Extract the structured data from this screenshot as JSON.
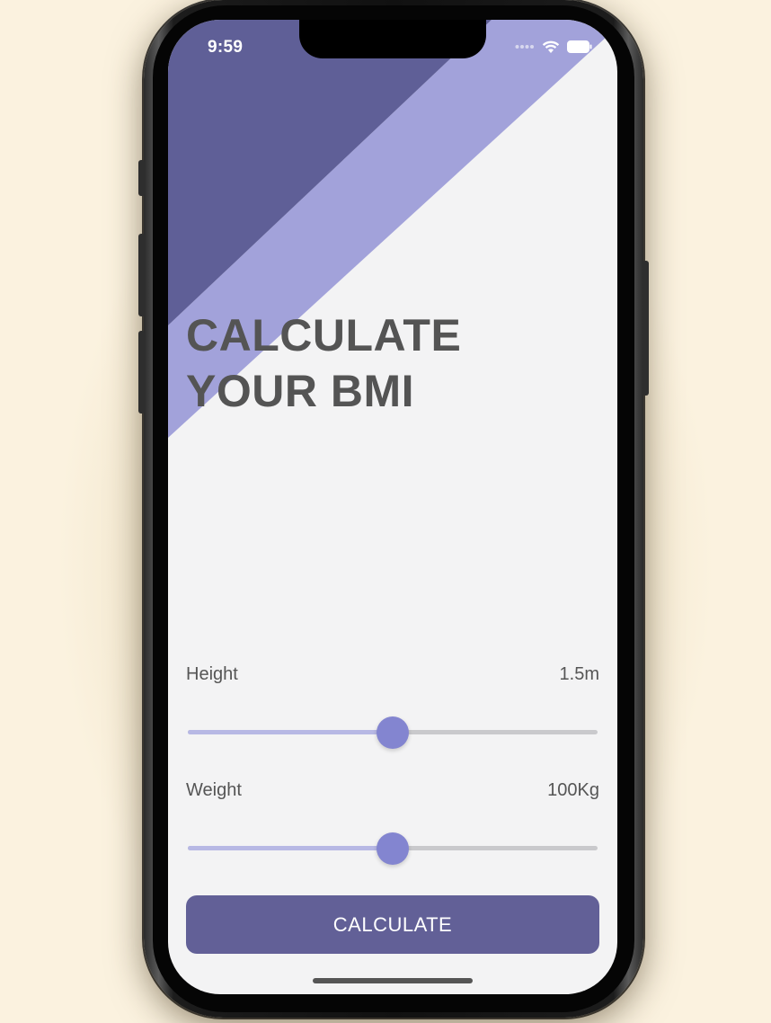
{
  "status_bar": {
    "time": "9:59",
    "signal_icon": "signal-dots-icon",
    "wifi_icon": "wifi-icon",
    "battery_icon": "battery-icon"
  },
  "theme": {
    "background": "#f3f3f4",
    "stripe_dark": "#5f5f97",
    "stripe_light": "#a2a2da",
    "accent": "#8385d0",
    "button": "#626097",
    "text": "#555555"
  },
  "headline": {
    "line1": "CALCULATE",
    "line2": "YOUR BMI"
  },
  "height": {
    "label": "Height",
    "value": "1.5m",
    "slider_fraction": 0.5
  },
  "weight": {
    "label": "Weight",
    "value": "100Kg",
    "slider_fraction": 0.5
  },
  "calculate_button": {
    "label": "CALCULATE"
  }
}
